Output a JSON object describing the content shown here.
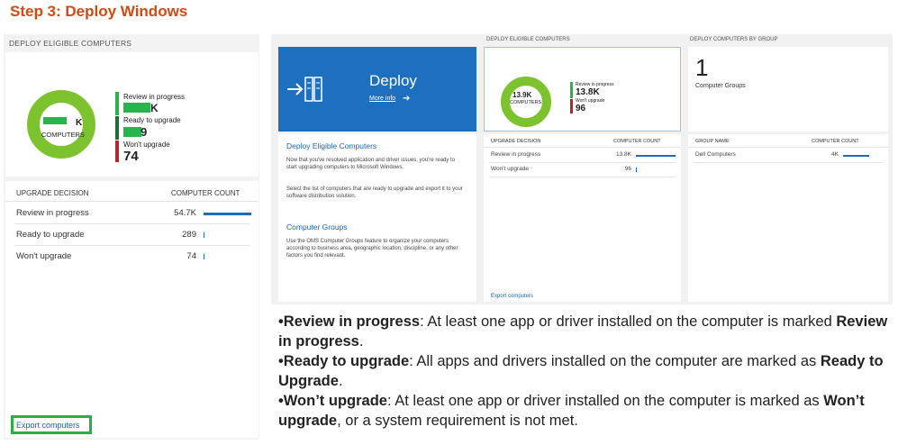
{
  "title": "Step 3: Deploy Windows",
  "left": {
    "header": "DEPLOY ELIGIBLE COMPUTERS",
    "donut": {
      "center_suffix": "K",
      "center_label": "COMPUTERS"
    },
    "legend": [
      {
        "label": "Review in progress",
        "value_suffix": "K",
        "color": "#27b34e"
      },
      {
        "label": "Ready to upgrade",
        "value_suffix": "9",
        "color": "#1b6e36"
      },
      {
        "label": "Won't upgrade",
        "value": "74",
        "color": "#b3262d"
      }
    ],
    "table": {
      "col1": "UPGRADE DECISION",
      "col2": "COMPUTER COUNT",
      "rows": [
        {
          "label": "Review in progress",
          "value": "54.7K",
          "fraction": 1.0
        },
        {
          "label": "Ready to upgrade",
          "value": "289",
          "fraction": 0.005
        },
        {
          "label": "Won't upgrade",
          "value": "74",
          "fraction": 0.002
        }
      ]
    },
    "export": "Export computers"
  },
  "right": {
    "deploy_tile": {
      "title": "Deploy",
      "link": "More info"
    },
    "deploy_text": {
      "heading1": "Deploy Eligible Computers",
      "para1": "Now that you've resolved application and driver issues, you're ready to start upgrading computers to Microsoft Windows.",
      "para2": "Select the list of computers that are ready to upgrade and export it to your software distribution solution.",
      "heading2": "Computer Groups",
      "para3": "Use the OMS Computer Groups feature to organize your computers according to business area, geographic location, discipline, or any other factors you find relevant."
    },
    "mid": {
      "header": "DEPLOY ELIGIBLE COMPUTERS",
      "donut": {
        "center_value": "13.9K",
        "center_label": "COMPUTERS"
      },
      "legend": [
        {
          "label": "Review in progress",
          "value": "13.8K",
          "color": "#27b34e"
        },
        {
          "label": "Won't upgrade",
          "value": "96",
          "color": "#b3262d"
        }
      ],
      "table": {
        "col1": "UPGRADE DECISION",
        "col2": "COMPUTER COUNT",
        "rows": [
          {
            "label": "Review in progress",
            "value": "13.8K",
            "fraction": 1.0
          },
          {
            "label": "Won't upgrade",
            "value": "96",
            "fraction": 0.007
          }
        ]
      },
      "export": "Export computers"
    },
    "groups": {
      "header": "DEPLOY COMPUTERS BY GROUP",
      "big": "1",
      "label": "Computer Groups",
      "table": {
        "col1": "GROUP NAME",
        "col2": "COMPUTER COUNT",
        "rows": [
          {
            "label": "Dell Computers",
            "value": "4K",
            "fraction": 1.0
          }
        ]
      }
    }
  },
  "description": [
    {
      "bullet": "•",
      "term": "Review in progress",
      "text1": ": At least one app or driver installed on the computer is marked ",
      "bold2": "Review in progress",
      "text2": "."
    },
    {
      "bullet": "•",
      "term": "Ready to upgrade",
      "text1": ": All apps and drivers installed on the computer are marked as ",
      "bold2": "Ready to Upgrade",
      "text2": "."
    },
    {
      "bullet": "•",
      "term": "Won’t upgrade",
      "text1": ": At least one app or driver installed on the computer is marked as ",
      "bold2": "Won’t upgrade",
      "text2": ", or a system requirement is not met."
    }
  ]
}
